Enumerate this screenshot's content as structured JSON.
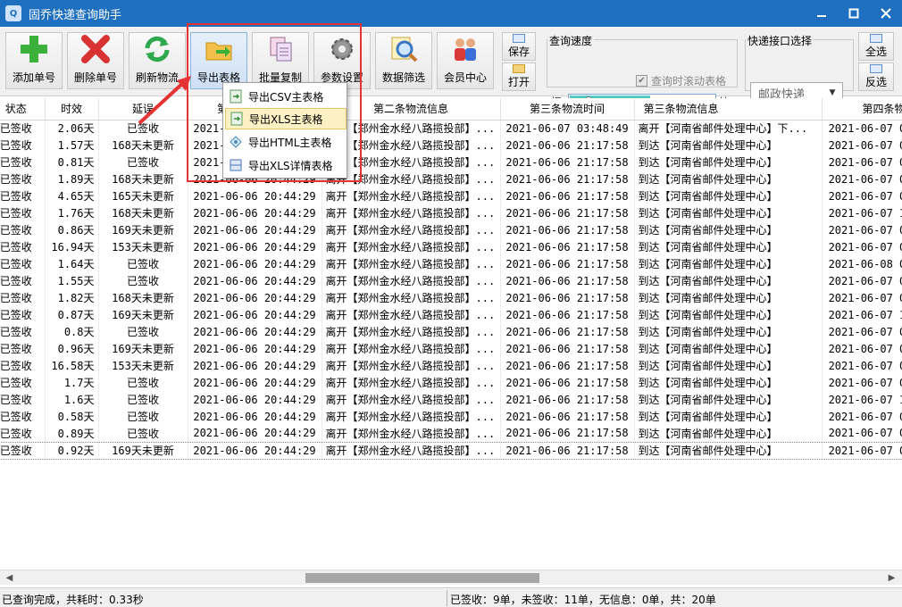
{
  "window": {
    "title": "固乔快递查询助手",
    "controls": [
      "minimize",
      "maximize",
      "close"
    ]
  },
  "toolbar": {
    "buttons": [
      {
        "label": "添加单号",
        "icon": "add-icon"
      },
      {
        "label": "删除单号",
        "icon": "delete-icon"
      },
      {
        "label": "刷新物流",
        "icon": "refresh-icon"
      },
      {
        "label": "导出表格",
        "icon": "folder-export-icon"
      },
      {
        "label": "批量复制",
        "icon": "copy-icon"
      },
      {
        "label": "参数设置",
        "icon": "gear-icon"
      },
      {
        "label": "数据筛选",
        "icon": "filter-search-icon"
      },
      {
        "label": "会员中心",
        "icon": "members-icon"
      }
    ],
    "save_label": "保存",
    "open_label": "打开",
    "select_all_label": "全选",
    "invert_label": "反选"
  },
  "query_speed": {
    "group_label": "查询速度",
    "slow_label": "慢",
    "fast_label": "快",
    "level": 0.1,
    "scroll_table_label": "查询时滚动表格",
    "scroll_table_checked": true
  },
  "courier": {
    "group_label": "快递接口选择",
    "selected": "邮政快递"
  },
  "export_menu": {
    "items": [
      "导出CSV主表格",
      "导出XLS主表格",
      "导出HTML主表格",
      "导出XLS详情表格"
    ],
    "highlighted_index": 1
  },
  "table": {
    "columns": [
      "状态",
      "时效",
      "延误",
      "第二条物流时间",
      "第二条物流信息",
      "第三条物流时间",
      "第三条物流信息",
      "第四条物流"
    ],
    "rows": [
      [
        "已签收",
        "2.06天",
        "已签收",
        "2021-06-06 20:44:29",
        "离开【郑州金水经八路揽投部】...",
        "2021-06-07 03:48:49",
        "离开【河南省邮件处理中心】下...",
        "2021-06-07 09"
      ],
      [
        "已签收",
        "1.57天",
        "168天未更新",
        "2021-06-06 20:44:29",
        "离开【郑州金水经八路揽投部】...",
        "2021-06-06 21:17:58",
        "到达【河南省邮件处理中心】",
        "2021-06-07 05"
      ],
      [
        "已签收",
        "0.81天",
        "已签收",
        "2021-06-06 20:44:29",
        "离开【郑州金水经八路揽投部】...",
        "2021-06-06 21:17:58",
        "到达【河南省邮件处理中心】",
        "2021-06-07 05"
      ],
      [
        "已签收",
        "1.89天",
        "168天未更新",
        "2021-06-06 20:44:29",
        "离开【郑州金水经八路揽投部】...",
        "2021-06-06 21:17:58",
        "到达【河南省邮件处理中心】",
        "2021-06-07 05"
      ],
      [
        "已签收",
        "4.65天",
        "165天未更新",
        "2021-06-06 20:44:29",
        "离开【郑州金水经八路揽投部】...",
        "2021-06-06 21:17:58",
        "到达【河南省邮件处理中心】",
        "2021-06-07 07"
      ],
      [
        "已签收",
        "1.76天",
        "168天未更新",
        "2021-06-06 20:44:29",
        "离开【郑州金水经八路揽投部】...",
        "2021-06-06 21:17:58",
        "到达【河南省邮件处理中心】",
        "2021-06-07 11"
      ],
      [
        "已签收",
        "0.86天",
        "169天未更新",
        "2021-06-06 20:44:29",
        "离开【郑州金水经八路揽投部】...",
        "2021-06-06 21:17:58",
        "到达【河南省邮件处理中心】",
        "2021-06-07 05"
      ],
      [
        "已签收",
        "16.94天",
        "153天未更新",
        "2021-06-06 20:44:29",
        "离开【郑州金水经八路揽投部】...",
        "2021-06-06 21:17:58",
        "到达【河南省邮件处理中心】",
        "2021-06-07 05"
      ],
      [
        "已签收",
        "1.64天",
        "已签收",
        "2021-06-06 20:44:29",
        "离开【郑州金水经八路揽投部】...",
        "2021-06-06 21:17:58",
        "到达【河南省邮件处理中心】",
        "2021-06-08 05"
      ],
      [
        "已签收",
        "1.55天",
        "已签收",
        "2021-06-06 20:44:29",
        "离开【郑州金水经八路揽投部】...",
        "2021-06-06 21:17:58",
        "到达【河南省邮件处理中心】",
        "2021-06-07 07"
      ],
      [
        "已签收",
        "1.82天",
        "168天未更新",
        "2021-06-06 20:44:29",
        "离开【郑州金水经八路揽投部】...",
        "2021-06-06 21:17:58",
        "到达【河南省邮件处理中心】",
        "2021-06-07 05"
      ],
      [
        "已签收",
        "0.87天",
        "169天未更新",
        "2021-06-06 20:44:29",
        "离开【郑州金水经八路揽投部】...",
        "2021-06-06 21:17:58",
        "到达【河南省邮件处理中心】",
        "2021-06-07 11"
      ],
      [
        "已签收",
        "0.8天",
        "已签收",
        "2021-06-06 20:44:29",
        "离开【郑州金水经八路揽投部】...",
        "2021-06-06 21:17:58",
        "到达【河南省邮件处理中心】",
        "2021-06-07 04"
      ],
      [
        "已签收",
        "0.96天",
        "169天未更新",
        "2021-06-06 20:44:29",
        "离开【郑州金水经八路揽投部】...",
        "2021-06-06 21:17:58",
        "到达【河南省邮件处理中心】",
        "2021-06-07 05"
      ],
      [
        "已签收",
        "16.58天",
        "153天未更新",
        "2021-06-06 20:44:29",
        "离开【郑州金水经八路揽投部】...",
        "2021-06-06 21:17:58",
        "到达【河南省邮件处理中心】",
        "2021-06-07 05"
      ],
      [
        "已签收",
        "1.7天",
        "已签收",
        "2021-06-06 20:44:29",
        "离开【郑州金水经八路揽投部】...",
        "2021-06-06 21:17:58",
        "到达【河南省邮件处理中心】",
        "2021-06-07 05"
      ],
      [
        "已签收",
        "1.6天",
        "已签收",
        "2021-06-06 20:44:29",
        "离开【郑州金水经八路揽投部】...",
        "2021-06-06 21:17:58",
        "到达【河南省邮件处理中心】",
        "2021-06-07 14"
      ],
      [
        "已签收",
        "0.58天",
        "已签收",
        "2021-06-06 20:44:29",
        "离开【郑州金水经八路揽投部】...",
        "2021-06-06 21:17:58",
        "到达【河南省邮件处理中心】",
        "2021-06-07 05"
      ],
      [
        "已签收",
        "0.89天",
        "已签收",
        "2021-06-06 20:44:29",
        "离开【郑州金水经八路揽投部】...",
        "2021-06-06 21:17:58",
        "到达【河南省邮件处理中心】",
        "2021-06-07 07"
      ],
      [
        "已签收",
        "0.92天",
        "169天未更新",
        "2021-06-06 20:44:29",
        "离开【郑州金水经八路揽投部】...",
        "2021-06-06 21:17:58",
        "到达【河南省邮件处理中心】",
        "2021-06-07 05"
      ]
    ]
  },
  "status": {
    "left": "已查询完成，共耗时：0.33秒",
    "right": "已签收：9单，未签收：11单，无信息：0单，共：20单"
  },
  "colors": {
    "titlebar": "#1e6fc0",
    "highlight_box": "#e53333",
    "menu_highlight": "#fcf1c4"
  }
}
